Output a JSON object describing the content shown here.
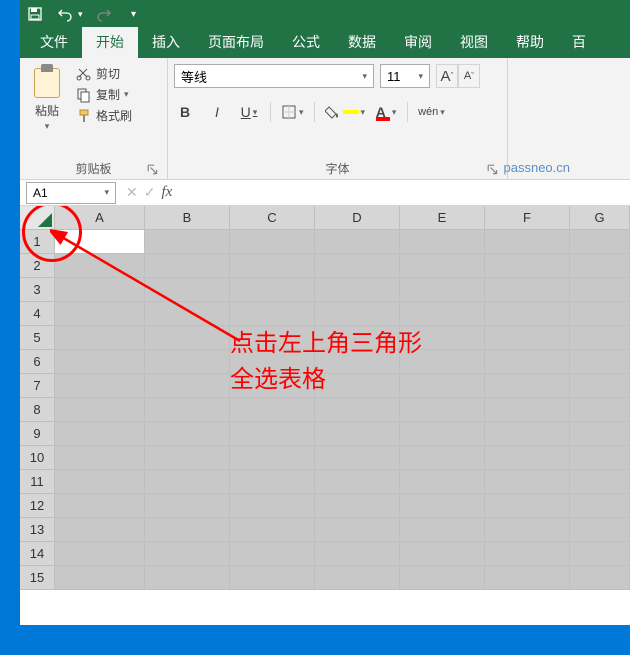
{
  "titlebar": {
    "save_icon": "save-icon",
    "undo_icon": "undo-icon",
    "redo_icon": "redo-icon",
    "qat_icon": "qat-icon"
  },
  "tabs": {
    "file": "文件",
    "home": "开始",
    "insert": "插入",
    "layout": "页面布局",
    "formula": "公式",
    "data": "数据",
    "review": "审阅",
    "view": "视图",
    "help": "帮助",
    "extra": "百"
  },
  "clipboard": {
    "paste": "粘贴",
    "cut": "剪切",
    "copy": "复制",
    "format_painter": "格式刷",
    "group_label": "剪贴板"
  },
  "font": {
    "name": "等线",
    "size": "11",
    "increase": "A",
    "decrease": "A",
    "bold": "B",
    "italic": "I",
    "underline": "U",
    "group_label": "字体",
    "wen": "wén"
  },
  "namebox": {
    "value": "A1",
    "cancel": "✕",
    "confirm": "✓",
    "fx": "fx"
  },
  "columns": [
    "A",
    "B",
    "C",
    "D",
    "E",
    "F",
    "G"
  ],
  "rows": [
    "1",
    "2",
    "3",
    "4",
    "5",
    "6",
    "7",
    "8",
    "9",
    "10",
    "11",
    "12",
    "13",
    "14",
    "15"
  ],
  "watermark": "passneo.cn",
  "annotation": {
    "line1": "点击左上角三角形",
    "line2": "全选表格"
  }
}
